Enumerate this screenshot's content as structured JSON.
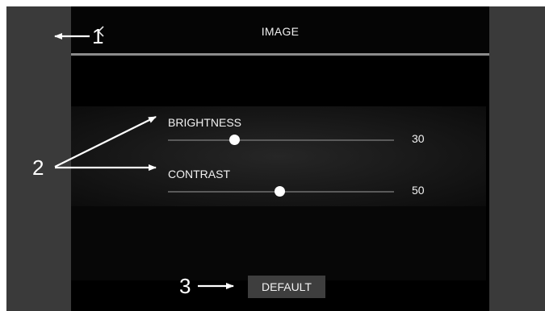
{
  "header": {
    "title": "IMAGE"
  },
  "settings": [
    {
      "label": "BRIGHTNESS",
      "value": "30",
      "level": 0.3
    },
    {
      "label": "CONTRAST",
      "value": "50",
      "level": 0.5
    }
  ],
  "default_button": {
    "label": "DEFAULT"
  },
  "callouts": {
    "back": "1",
    "sliders": "2",
    "default": "3"
  },
  "icons": {
    "back": "chevron-left-icon"
  }
}
